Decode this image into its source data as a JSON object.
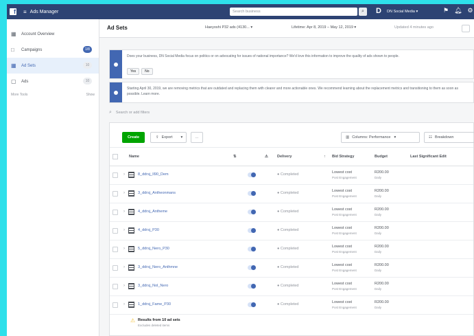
{
  "topbar": {
    "logo": "f",
    "menu_icon": "≡",
    "title": "Ads Manager",
    "search_placeholder": "Search business",
    "search_icon": "⌕",
    "account_logo": "D",
    "account_name": "DN Social Media ▾",
    "icons": [
      "flag-icon",
      "bell-icon",
      "gear-icon"
    ]
  },
  "sidebar": {
    "items": [
      {
        "icon": "▦",
        "label": "Account Overview",
        "badge": ""
      },
      {
        "icon": "□",
        "label": "Campaigns",
        "badge": "1/8"
      },
      {
        "icon": "▦",
        "label": "Ad Sets",
        "badge": "10"
      },
      {
        "icon": "▢",
        "label": "Ads",
        "badge": "10"
      }
    ],
    "tools_left": "More Tools",
    "tools_right": "Show"
  },
  "header": {
    "title": "Ad Sets",
    "campaign_select": "Haeyoshi P32 ads (4130...",
    "date_range": "Lifetime: Apr 8, 2019 – May 12, 2019",
    "updated": "Updated 4 minutes ago"
  },
  "banners": [
    {
      "text": "Does your business, DN Social Media focus on politics or on advocating for issues of national importance? We'd love this information to improve the quality of ads shown to people.",
      "buttons": [
        "Yes",
        "No"
      ]
    },
    {
      "text": "Starting April 30, 2019, we are removing metrics that are outdated and replacing them with clearer and more actionable ones. We recommend learning about the replacement metrics and transitioning to them as soon as possible. Learn more."
    }
  ],
  "search": {
    "placeholder": "Search or add filters"
  },
  "toolbar": {
    "create": "Create",
    "export": "Export",
    "more": "...",
    "columns": "Columns: Performance",
    "breakdown": "Breakdown"
  },
  "table": {
    "headers": {
      "name": "Name",
      "delivery": "Delivery",
      "bid_strategy": "Bid Strategy",
      "budget": "Budget",
      "last_edit": "Last Significant Edit"
    },
    "rows": [
      {
        "name": "8_ddrsj_Il90_Dem",
        "delivery": "● Completed",
        "strategy": "Lowest cost",
        "strategy_sub": "Post Engagement",
        "budget": "R200.00",
        "budget_sub": "Daily"
      },
      {
        "name": "3_ddrsj_Antheonmans",
        "delivery": "● Completed",
        "strategy": "Lowest cost",
        "strategy_sub": "Post Engagement",
        "budget": "R200.00",
        "budget_sub": "Daily"
      },
      {
        "name": "4_ddrsj_Antheme",
        "delivery": "● Completed",
        "strategy": "Lowest cost",
        "strategy_sub": "Post Engagement",
        "budget": "R200.00",
        "budget_sub": "Daily"
      },
      {
        "name": "4_ddrsj_P30",
        "delivery": "● Completed",
        "strategy": "Lowest cost",
        "strategy_sub": "Post Engagement",
        "budget": "R200.00",
        "budget_sub": "Daily"
      },
      {
        "name": "5_ddrsj_Nero_P30",
        "delivery": "● Completed",
        "strategy": "Lowest cost",
        "strategy_sub": "Post Engagement",
        "budget": "R200.00",
        "budget_sub": "Daily"
      },
      {
        "name": "3_ddrsj_Nero_Anthmne",
        "delivery": "● Completed",
        "strategy": "Lowest cost",
        "strategy_sub": "Post Engagement",
        "budget": "R200.00",
        "budget_sub": "Daily"
      },
      {
        "name": "3_ddrsj_Nol_Nero",
        "delivery": "● Completed",
        "strategy": "Lowest cost",
        "strategy_sub": "Post Engagement",
        "budget": "R200.00",
        "budget_sub": "Daily"
      },
      {
        "name": "1_ddrsj_Fame_P30",
        "delivery": "● Completed",
        "strategy": "Lowest cost",
        "strategy_sub": "Post Engagement",
        "budget": "R200.00",
        "budget_sub": "Daily"
      }
    ],
    "results_text": "Results from 10 ad sets",
    "results_sub": "Excludes deleted items"
  },
  "colors": {
    "topbar": "#2d4373",
    "accent": "#4267b2",
    "create": "#00a400",
    "background": "#2ee0ea"
  }
}
